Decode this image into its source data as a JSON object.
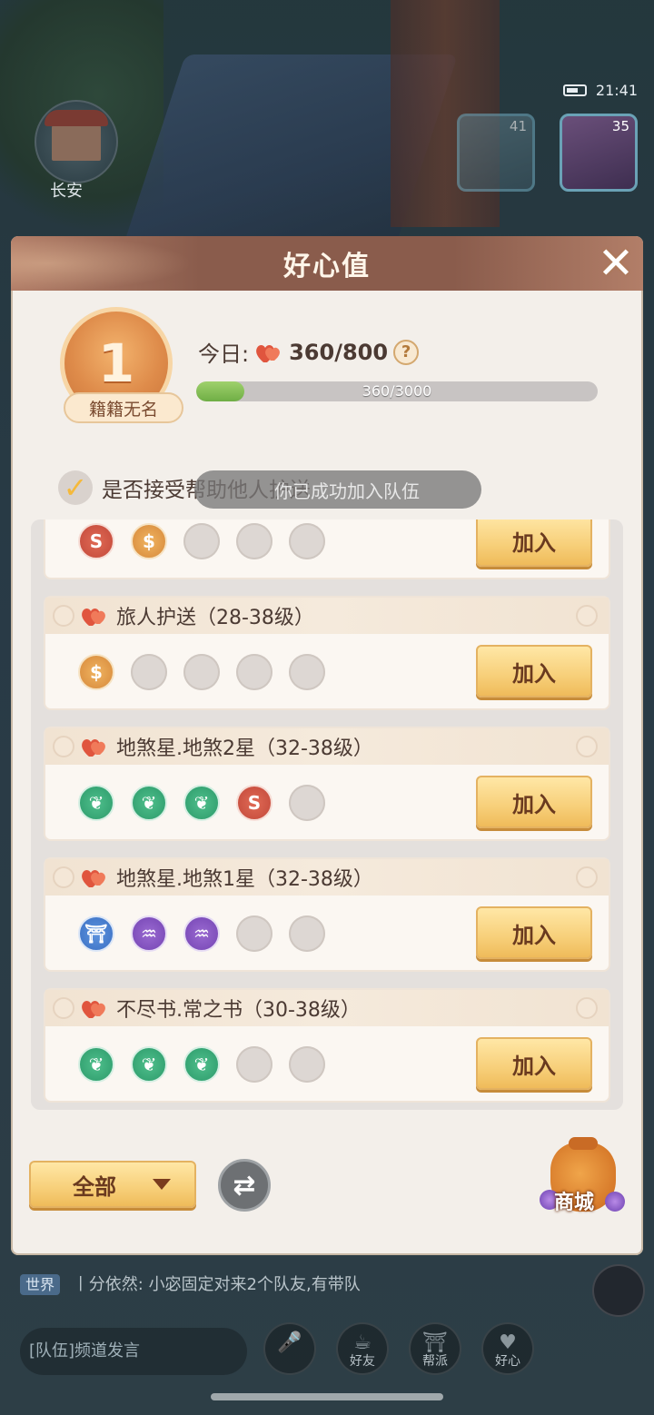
{
  "background": {
    "city_name": "长安",
    "clock": "21:41",
    "avatar_levels": [
      "41",
      "35"
    ],
    "chat_line_channel": "世界",
    "chat_line_user": "丨分依然:",
    "chat_line_text": "小宓固定对来2个队友,有带队",
    "chat_input_placeholder": "[队伍]频道发言",
    "nav": [
      {
        "label": "",
        "icon": "microphone-icon"
      },
      {
        "label": "好友",
        "icon": "friends-icon"
      },
      {
        "label": "帮派",
        "icon": "guild-icon"
      },
      {
        "label": "好心",
        "icon": "heart-icon"
      }
    ]
  },
  "modal": {
    "title": "好心值",
    "close_label": "✕",
    "rank": {
      "number": "1",
      "name": "籍籍无名"
    },
    "today": {
      "label": "今日:",
      "value": "360/800",
      "help": "?"
    },
    "progress": {
      "text": "360/3000",
      "value": 360,
      "max": 3000
    },
    "accept_label": "是否接受帮助他人护送",
    "toast": "你已成功加入队伍",
    "tasks": [
      {
        "title": "",
        "slots": [
          "red",
          "gold",
          "empty",
          "empty",
          "empty"
        ],
        "join_label": "加入"
      },
      {
        "title": "旅人护送（28-38级）",
        "slots": [
          "gold",
          "empty",
          "empty",
          "empty",
          "empty"
        ],
        "join_label": "加入"
      },
      {
        "title": "地煞星.地煞2星（32-38级）",
        "slots": [
          "green",
          "green",
          "green",
          "red",
          "empty"
        ],
        "join_label": "加入"
      },
      {
        "title": "地煞星.地煞1星（32-38级）",
        "slots": [
          "blue",
          "purple",
          "purple",
          "empty",
          "empty"
        ],
        "join_label": "加入"
      },
      {
        "title": "不尽书.常之书（30-38级）",
        "slots": [
          "green",
          "green",
          "green",
          "empty",
          "empty"
        ],
        "join_label": "加入"
      }
    ],
    "filter_label": "全部",
    "refresh_icon": "refresh-icon",
    "shop_label": "商城"
  }
}
